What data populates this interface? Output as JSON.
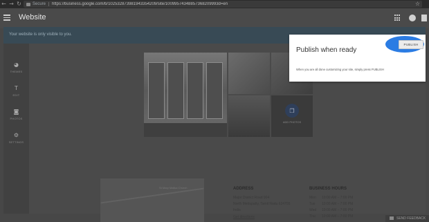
{
  "browser": {
    "secure_label": "Secure",
    "url": "https://business.google.com/b/102532873981943354209/site/10099574348857368209993d=en"
  },
  "appbar": {
    "title": "Website"
  },
  "banner": {
    "text": "Your website is only visible to you."
  },
  "sidebar": {
    "items": [
      {
        "label": "THEMES",
        "icon": "palette-icon"
      },
      {
        "label": "EDIT",
        "icon": "text-edit-icon"
      },
      {
        "label": "PHOTOS",
        "icon": "camera-icon"
      },
      {
        "label": "SETTINGS",
        "icon": "gear-icon"
      }
    ]
  },
  "gallery": {
    "add_photos_label": "ADD PHOTOS"
  },
  "map": {
    "label": "St Mary Malika Church"
  },
  "address": {
    "heading": "ADDRESS",
    "lines": [
      "Major District Road 904",
      "North Mettupatty, Tamil Nadu 624705",
      "India"
    ],
    "directions_link": "Get directions"
  },
  "hours": {
    "heading": "BUSINESS HOURS",
    "rows": [
      {
        "day": "Mon",
        "time": "10:00 AM – 7:00 PM"
      },
      {
        "day": "Tue",
        "time": "10:00 AM – 7:00 PM"
      },
      {
        "day": "Wed",
        "time": "10:00 AM – 7:00 PM"
      },
      {
        "day": "Thu",
        "time": "10:00 AM – 7:00 PM"
      }
    ]
  },
  "feedback": {
    "label": "SEND FEEDBACK"
  },
  "publish_card": {
    "title": "Publish when ready",
    "description": "When you are all done customizing your site, simply press PUBLISH",
    "button_label": "PUBLISH",
    "highlight_color": "#2b7ce3"
  }
}
